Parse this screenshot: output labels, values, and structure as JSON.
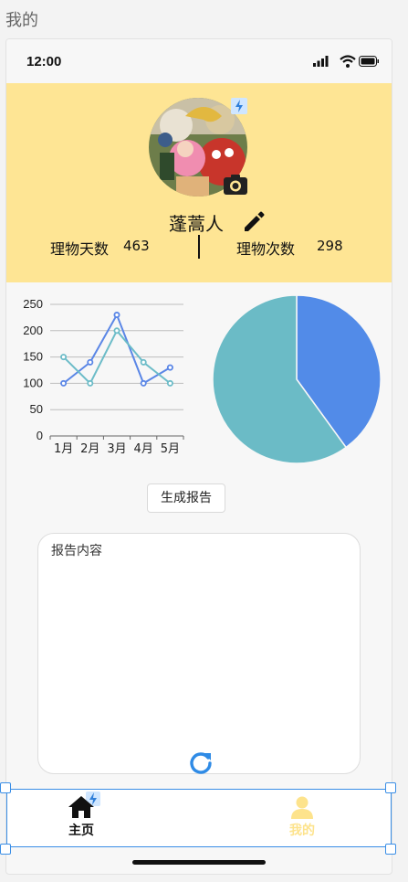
{
  "page": {
    "title": "我的"
  },
  "status_bar": {
    "time": "12:00"
  },
  "profile": {
    "username": "蓬蒿人",
    "days_label": "理物天数",
    "days_value": "463",
    "count_label": "理物次数",
    "count_value": "298",
    "colors": {
      "background": "#fee594"
    }
  },
  "chart_data": [
    {
      "type": "line",
      "categories": [
        "1月",
        "2月",
        "3月",
        "4月",
        "5月"
      ],
      "yticks": [
        "0",
        "50",
        "100",
        "150",
        "200",
        "250"
      ],
      "ylim": [
        0,
        250
      ],
      "grid": true,
      "series": [
        {
          "values": [
            100,
            140,
            230,
            100,
            130
          ],
          "color": "#5a86e6"
        },
        {
          "values": [
            150,
            100,
            200,
            140,
            100
          ],
          "color": "#6cbcc8"
        }
      ]
    },
    {
      "type": "pie",
      "values": [
        40,
        60
      ],
      "colors": [
        "#528be8",
        "#6bbbc6"
      ]
    }
  ],
  "actions": {
    "generate_label": "生成报告"
  },
  "report": {
    "label": "报告内容"
  },
  "tabbar": {
    "home_label": "主页",
    "mine_label": "我的",
    "active_color": "#fde38c"
  }
}
